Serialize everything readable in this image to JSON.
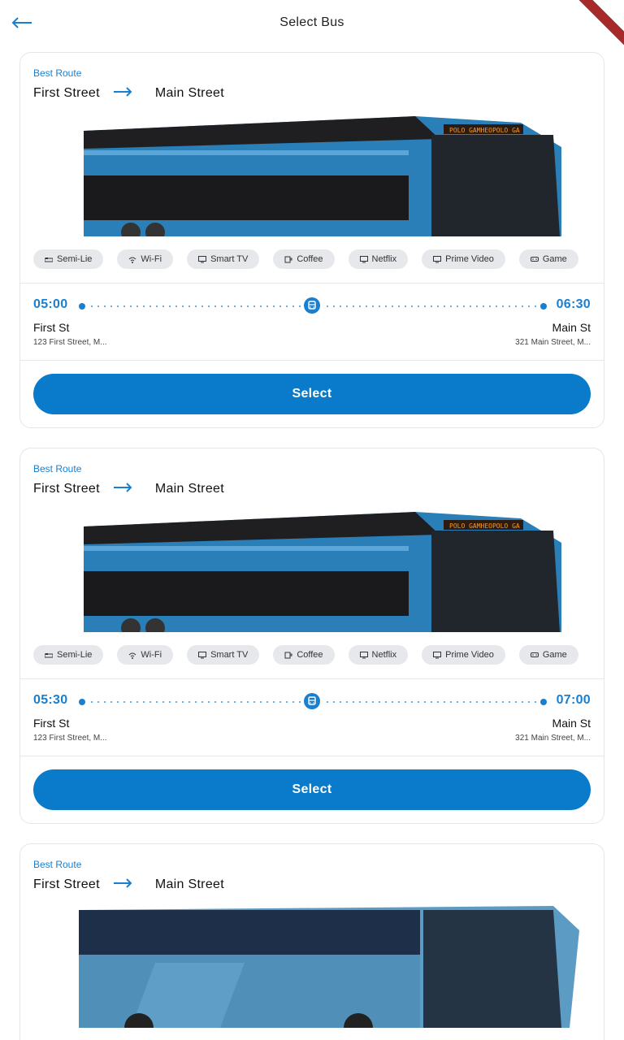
{
  "header": {
    "title": "Select Bus",
    "back_icon": "back-arrow-icon"
  },
  "accent_color": "#1a7fcf",
  "amenities": [
    {
      "label": "Semi-Lie",
      "icon": "bed-icon"
    },
    {
      "label": "Wi-Fi",
      "icon": "wifi-icon"
    },
    {
      "label": "Smart TV",
      "icon": "tv-icon"
    },
    {
      "label": "Coffee",
      "icon": "coffee-icon"
    },
    {
      "label": "Netflix",
      "icon": "tv-icon"
    },
    {
      "label": "Prime Video",
      "icon": "tv-icon"
    },
    {
      "label": "Game",
      "icon": "gamepad-icon"
    }
  ],
  "buses": [
    {
      "tag": "Best Route",
      "origin": "First Street",
      "destination": "Main Street",
      "departure_time": "05:00",
      "arrival_time": "06:30",
      "departure_stop": "First St",
      "arrival_stop": "Main St",
      "departure_address": "123 First Street, M...",
      "arrival_address": "321 Main Street, M...",
      "select_label": "Select"
    },
    {
      "tag": "Best Route",
      "origin": "First Street",
      "destination": "Main Street",
      "departure_time": "05:30",
      "arrival_time": "07:00",
      "departure_stop": "First St",
      "arrival_stop": "Main St",
      "departure_address": "123 First Street, M...",
      "arrival_address": "321 Main Street, M...",
      "select_label": "Select"
    },
    {
      "tag": "Best Route",
      "origin": "First Street",
      "destination": "Main Street"
    }
  ]
}
